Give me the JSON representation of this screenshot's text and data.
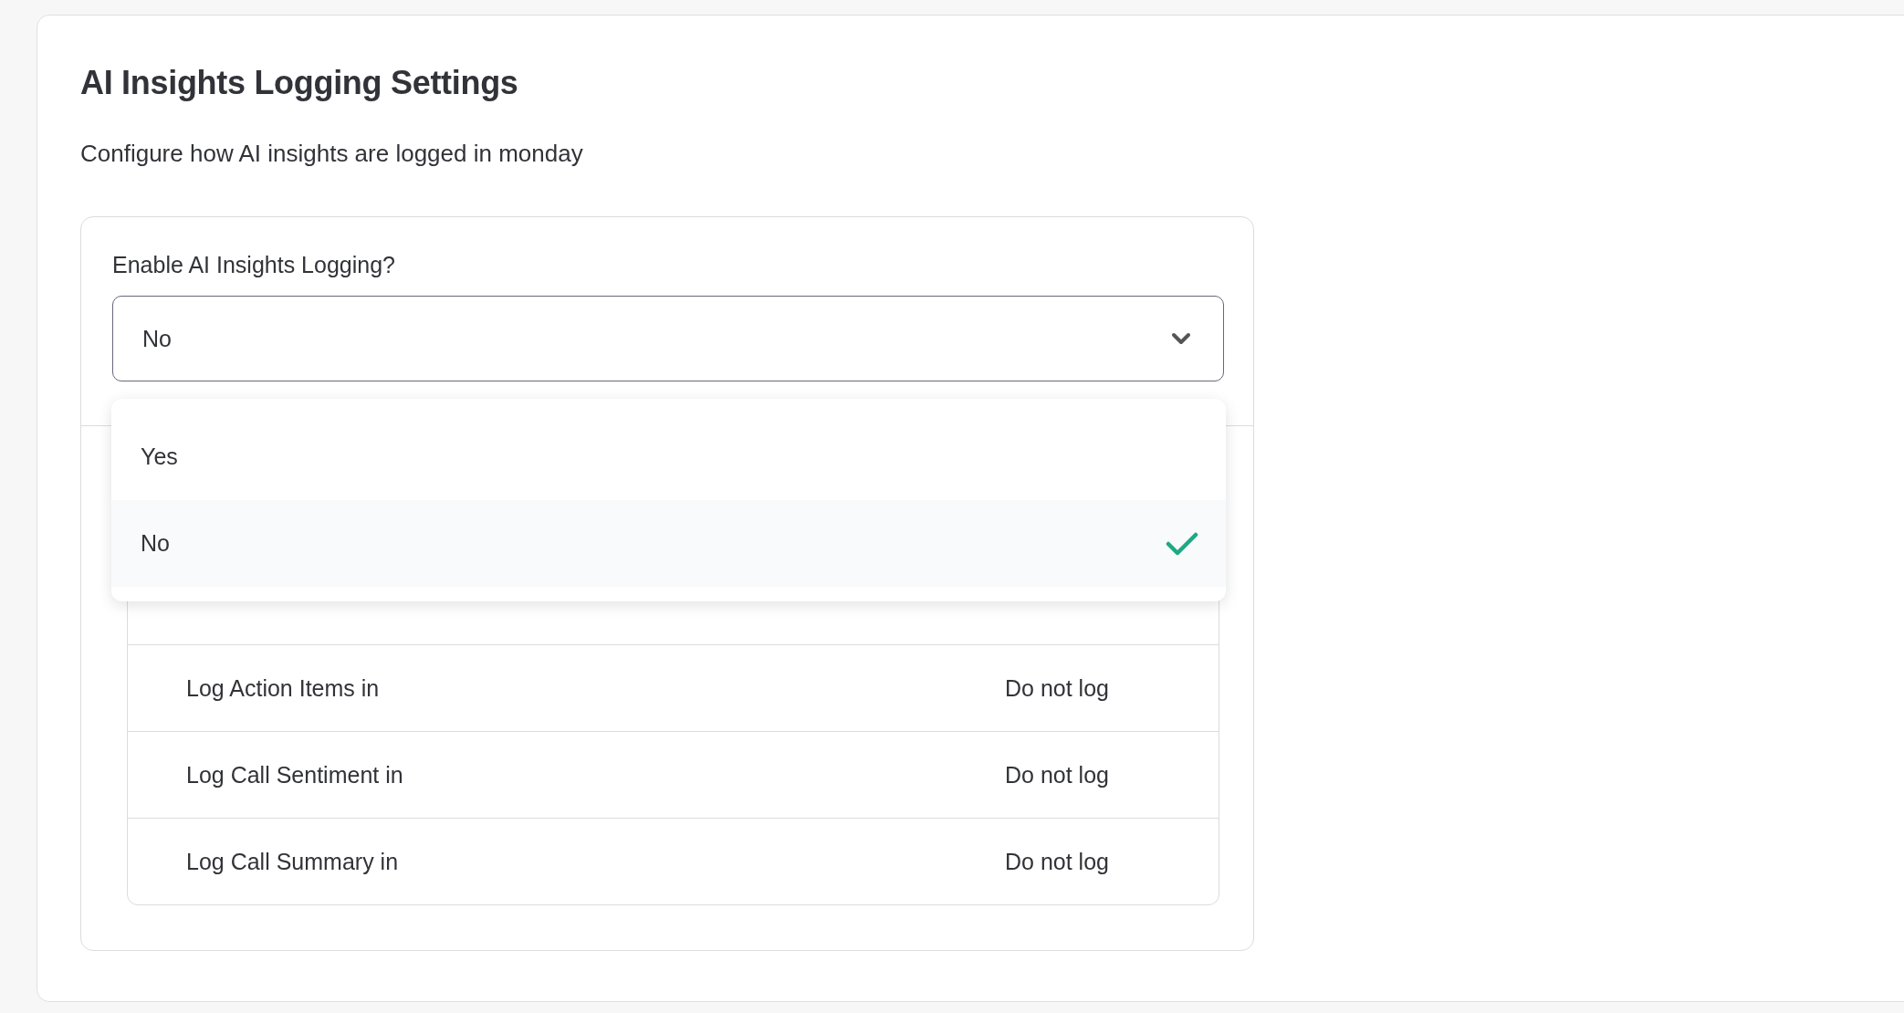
{
  "page": {
    "title": "AI Insights Logging Settings",
    "description": "Configure how AI insights are logged in monday"
  },
  "setting": {
    "label": "Enable AI Insights Logging?",
    "select": {
      "value": "No",
      "expanded": true,
      "options": [
        {
          "label": "Yes",
          "selected": false
        },
        {
          "label": "No",
          "selected": true
        }
      ]
    }
  },
  "table": {
    "rows": [
      {
        "label": "Log Action Items in",
        "value": "Do not log"
      },
      {
        "label": "Log Call Sentiment in",
        "value": "Do not log"
      },
      {
        "label": "Log Call Summary in",
        "value": "Do not log"
      }
    ]
  }
}
